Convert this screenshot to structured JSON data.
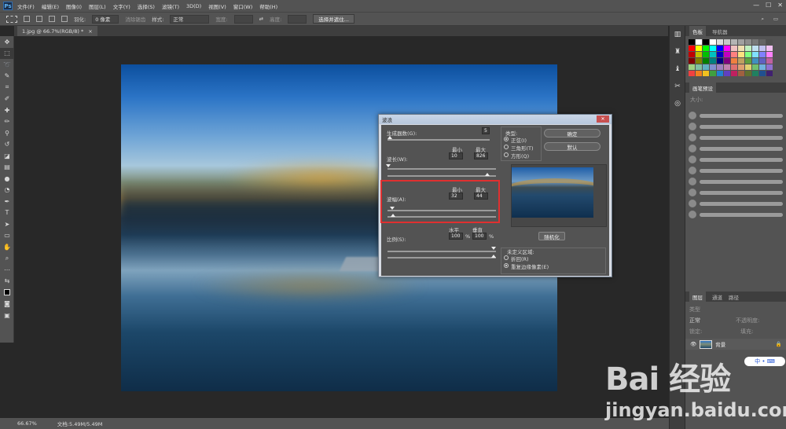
{
  "app": {
    "logo": "Ps",
    "menu": [
      "文件(F)",
      "编辑(E)",
      "图像(I)",
      "图层(L)",
      "文字(Y)",
      "选择(S)",
      "滤镜(T)",
      "3D(D)",
      "视图(V)",
      "窗口(W)",
      "帮助(H)"
    ],
    "window_controls": [
      "—",
      "☐",
      "✕"
    ]
  },
  "options_bar": {
    "feather_label": "羽化:",
    "feather_value": "0 像素",
    "antialias_label": "消除锯齿",
    "style_label": "样式:",
    "style_value": "正常",
    "width_label": "宽度:",
    "height_label": "高度:",
    "select_mask_button": "选择并遮住..."
  },
  "document": {
    "tab_title": "1.jpg @ 66.7%(RGB/8) *",
    "tab_close": "×"
  },
  "status": {
    "zoom": "66.67%",
    "doc_info": "文档:5.49M/5.49M"
  },
  "panels": {
    "swatches_tabs": [
      "色板",
      "导航器"
    ],
    "brushes_tab": "画笔预设",
    "brush_size_label": "大小:",
    "layers_tabs": [
      "图层",
      "通道",
      "路径"
    ],
    "layer_kind": "类型",
    "blend_mode": "正常",
    "opacity_label": "不透明度:",
    "lock_label": "锁定:",
    "fill_label": "填充:",
    "layer_name": "背景"
  },
  "swatch_colors": [
    "#000000",
    "#ffffff",
    "#000000",
    "#ffffff",
    "#dcdcdc",
    "#c8c8c8",
    "#b4b4b4",
    "#a0a0a0",
    "#8c8c8c",
    "#787878",
    "#646464",
    "#505050",
    "#ff0000",
    "#ffff00",
    "#00ff00",
    "#00ffff",
    "#0000ff",
    "#ff00ff",
    "#f0c0c0",
    "#f0e0b0",
    "#c0f0c0",
    "#c0e0f0",
    "#c0c0f0",
    "#f0c0f0",
    "#c00000",
    "#c0c000",
    "#00c000",
    "#00c0c0",
    "#0000c0",
    "#c000c0",
    "#ff8080",
    "#ffe080",
    "#80ff80",
    "#80e0ff",
    "#8080ff",
    "#ff80ff",
    "#800000",
    "#808000",
    "#008000",
    "#008080",
    "#000080",
    "#800080",
    "#f08040",
    "#c0a060",
    "#60a040",
    "#4090c0",
    "#6060c0",
    "#c060a0",
    "#a0d080",
    "#80c0a0",
    "#60b0c0",
    "#8090d0",
    "#a080c0",
    "#c080b0",
    "#e07070",
    "#e0a070",
    "#e0d070",
    "#70c070",
    "#70b0e0",
    "#9070d0",
    "#f04040",
    "#f08020",
    "#f0c020",
    "#40a040",
    "#2080d0",
    "#6040c0",
    "#c02060",
    "#a06040",
    "#607030",
    "#208060",
    "#205090",
    "#402070"
  ],
  "filter_dialog": {
    "title": "波浪",
    "close": "✕",
    "generators_label": "生成器数(G):",
    "generators_value": "5",
    "wavelength_label": "波长(W):",
    "min_label": "最小",
    "max_label": "最大",
    "wavelength_min": "10",
    "wavelength_max": "826",
    "amplitude_label": "波幅(A):",
    "amplitude_min": "32",
    "amplitude_max": "44",
    "scale_label": "比例(S):",
    "horizontal_label": "水平",
    "vertical_label": "垂直",
    "scale_h": "100",
    "scale_v": "100",
    "percent": "%",
    "type_label": "类型:",
    "type_options": [
      "正弦(I)",
      "三角形(T)",
      "方形(Q)"
    ],
    "ok_button": "确定",
    "cancel_button": "默认",
    "randomize_button": "随机化",
    "undefined_area_label": "未定义区域:",
    "undefined_options": [
      "折回(R)",
      "重复边缘像素(E)"
    ]
  },
  "watermark": {
    "brand": "Bai 经验",
    "url": "jingyan.baidu.com"
  },
  "ime": "中 • ⌨"
}
